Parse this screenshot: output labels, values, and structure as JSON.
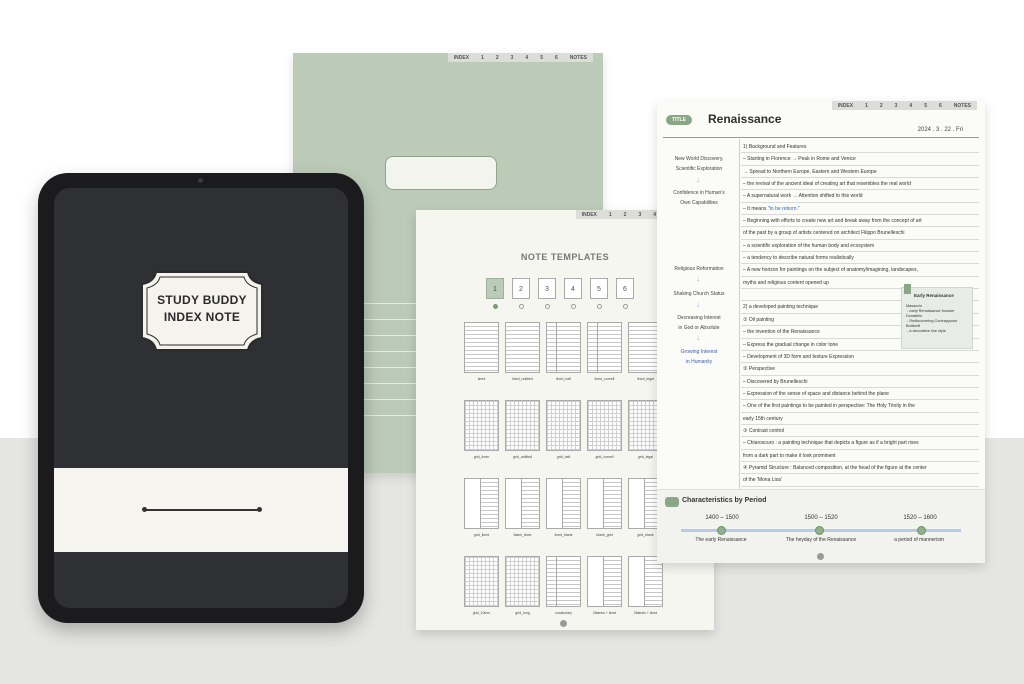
{
  "tablet": {
    "cover_title_line1": "STUDY BUDDY",
    "cover_title_line2": "INDEX NOTE"
  },
  "tabs": [
    "INDEX",
    "1",
    "2",
    "3",
    "4",
    "5",
    "6",
    "NOTES"
  ],
  "templates": {
    "title": "NOTE TEMPLATES",
    "numbers": [
      "1",
      "2",
      "3",
      "4",
      "5",
      "6"
    ],
    "items": [
      {
        "label": "lined",
        "style": "lined"
      },
      {
        "label": "lined_untitled",
        "style": "lined"
      },
      {
        "label": "lined_half",
        "style": "cornell"
      },
      {
        "label": "lined_cornell",
        "style": "cornell"
      },
      {
        "label": "lined_legal",
        "style": "lined"
      },
      {
        "label": "grid_4mm",
        "style": "grid"
      },
      {
        "label": "grid_untitled",
        "style": "grid"
      },
      {
        "label": "grid_half",
        "style": "grid"
      },
      {
        "label": "grid_cornell",
        "style": "grid"
      },
      {
        "label": "grid_legal",
        "style": "grid"
      },
      {
        "label": "grid_lined",
        "style": "mixed"
      },
      {
        "label": "blank_lined",
        "style": "mixed"
      },
      {
        "label": "lined_blank",
        "style": "mixed"
      },
      {
        "label": "blank_grid",
        "style": "mixed"
      },
      {
        "label": "grid_blank",
        "style": "mixed"
      },
      {
        "label": "grid_10mm",
        "style": "grid"
      },
      {
        "label": "grid_long",
        "style": "grid"
      },
      {
        "label": "vocabulary",
        "style": "cornell"
      },
      {
        "label": "2blanks + lined",
        "style": "mixed"
      },
      {
        "label": "2blanks + lined",
        "style": "mixed"
      }
    ]
  },
  "note": {
    "badge": "TITLE",
    "title": "Renaissance",
    "date": "2024 .  3 . 22 . Fri",
    "cues": [
      "New World Discovery,",
      "Scientific Exploration",
      "Confidence in Human's",
      "Own Capabilities",
      "Religious Reformation",
      "Shaking Church Status",
      "Decreasing Interest",
      "in God or Absolute",
      "Growing Interest",
      "in Humanity"
    ],
    "lines": [
      "1) Background and Features",
      "– Starting in Florence → Peak in Rome and Venice",
      "   → Spread to Northern Europe, Eastern and Western Europe",
      "– the revival of the ancient ideal of creating art that resembles the real world",
      "– A supernatural work → Attention shifted to this world",
      "– It means \"to be reborn.\"",
      "– Beginning with efforts to create new art and break away from the concept of art",
      "   of the past by a group of artists centered on architect Filippo Brunelleschi",
      "– a scientific exploration of the human body and ecosystem",
      "– a tendency to describe natural forms realistically",
      "– A new horizon for paintings on the subject of anatomy/imagining, landscapes,",
      "   myths and religious content opened up",
      "",
      "2) a developed painting technique",
      "① Oil painting",
      "   – the invention of the Renaissance",
      "   – Express the gradual change in color tone",
      "   – Development of 3D form and texture Expression",
      "② Perspective",
      "   – Discovered by Brunelleschi",
      "   – Expression of the sense of space and distance behind the plane",
      "   – One of the first paintings to be painted in perspective: The Holy Trinity in the",
      "      early 15th century",
      "③ Contrast control",
      "   – Chiaroscuro : a painting technique that depicts a figure as if a bright part rises",
      "                  from a dark part to make it look prominent",
      "④ Pyramid Structure : Balanced composition, at the head of the figure at the center",
      "                  of the 'Mona Lisa'"
    ],
    "sticky": {
      "title": "Early Renaissance",
      "body": "Masaccio\n - early Renaissance founder\nDonatello\n - Rediscovering Contrapposto\nBotticelli\n - a decorative line style"
    },
    "period": {
      "title": "Characteristics by Period",
      "items": [
        {
          "years": "1400 – 1500",
          "label": "The early Renaissance"
        },
        {
          "years": "1500 – 1520",
          "label": "The heyday of the Renaissance"
        },
        {
          "years": "1520 – 1600",
          "label": "a period of mannerism"
        }
      ]
    }
  },
  "colors": {
    "sage": "#bccbb7",
    "accent": "#8aa687",
    "dark_cover": "#2f3033",
    "highlight_blue": "#2d67c9"
  }
}
